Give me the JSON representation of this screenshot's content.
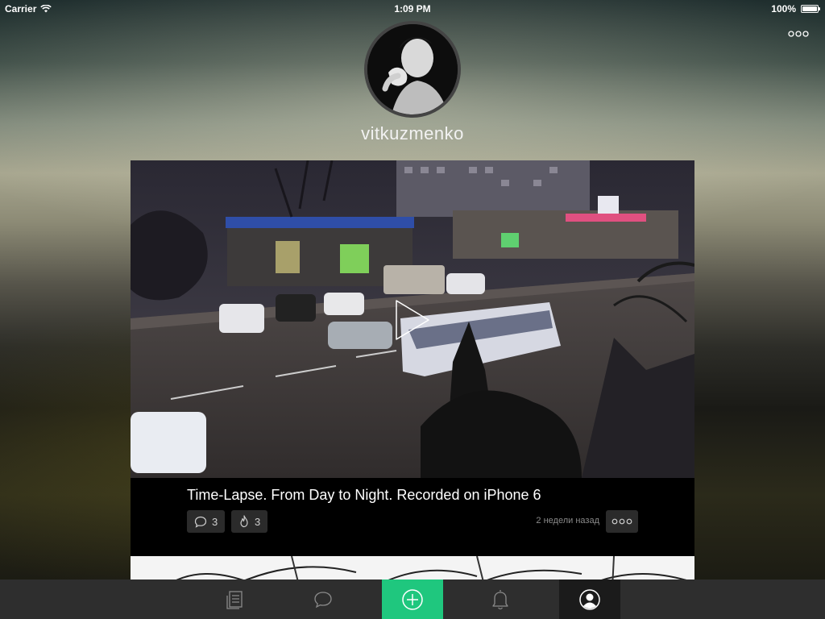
{
  "status_bar": {
    "carrier": "Carrier",
    "time": "1:09 PM",
    "battery": "100%"
  },
  "profile": {
    "username": "vitkuzmenko"
  },
  "post": {
    "title": "Time-Lapse. From Day to Night. Recorded on iPhone 6",
    "comments_count": "3",
    "likes_count": "3",
    "time_ago": "2 недели назад"
  },
  "tab_bar": {
    "items": [
      {
        "icon": "feed-icon"
      },
      {
        "icon": "chat-bubble-icon"
      },
      {
        "icon": "plus-circle-icon"
      },
      {
        "icon": "bell-icon"
      },
      {
        "icon": "profile-icon"
      }
    ],
    "active_index": 4
  },
  "colors": {
    "accent": "#1fc77e",
    "tab_bar": "#2e2e2e",
    "card": "#000000"
  }
}
